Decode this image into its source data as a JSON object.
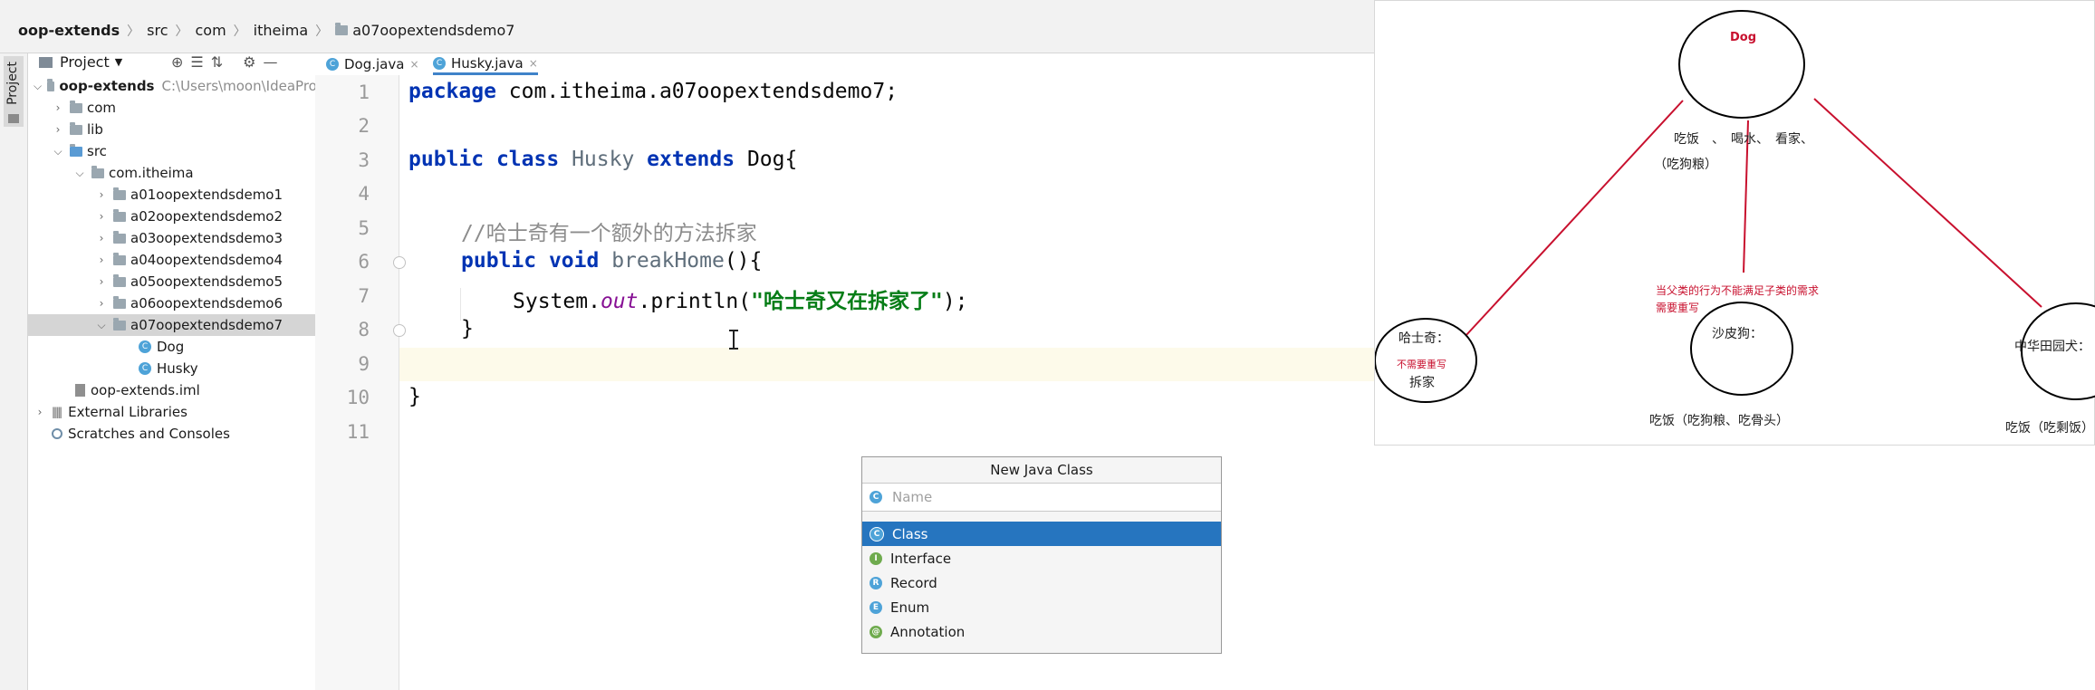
{
  "breadcrumb": [
    "oop-extends",
    "src",
    "com",
    "itheima",
    "a07oopextendsdemo7"
  ],
  "sidebar_stripe": {
    "label": "Project"
  },
  "project_panel": {
    "title": "Project",
    "tools": [
      "⊕",
      "☰",
      "⇅",
      "⚙",
      "—"
    ],
    "tree": [
      {
        "label": "oop-extends",
        "extra": "C:\\Users\\moon\\IdeaProj",
        "icon": "folder-icon",
        "expanded": true
      },
      {
        "label": "com",
        "icon": "folder-icon"
      },
      {
        "label": "lib",
        "icon": "folder-icon"
      },
      {
        "label": "src",
        "icon": "folder-icon",
        "expanded": true
      },
      {
        "label": "com.itheima",
        "icon": "folder-icon",
        "expanded": true
      },
      {
        "label": "a01oopextendsdemo1",
        "icon": "package-icon"
      },
      {
        "label": "a02oopextendsdemo2",
        "icon": "package-icon"
      },
      {
        "label": "a03oopextendsdemo3",
        "icon": "package-icon"
      },
      {
        "label": "a04oopextendsdemo4",
        "icon": "package-icon"
      },
      {
        "label": "a05oopextendsdemo5",
        "icon": "package-icon"
      },
      {
        "label": "a06oopextendsdemo6",
        "icon": "package-icon"
      },
      {
        "label": "a07oopextendsdemo7",
        "icon": "package-icon",
        "expanded": true,
        "selected": true
      },
      {
        "label": "Dog",
        "icon": "class-icon"
      },
      {
        "label": "Husky",
        "icon": "class-icon"
      },
      {
        "label": "oop-extends.iml",
        "icon": "iml-file-icon"
      },
      {
        "label": "External Libraries",
        "icon": "library-icon"
      },
      {
        "label": "Scratches and Consoles",
        "icon": "scratches-icon"
      }
    ]
  },
  "editor": {
    "tabs": [
      {
        "label": "Dog.java",
        "close": "×"
      },
      {
        "label": "Husky.java",
        "close": "×",
        "active": true
      }
    ],
    "line_numbers": [
      "1",
      "2",
      "3",
      "4",
      "5",
      "6",
      "7",
      "8",
      "9",
      "10",
      "11"
    ],
    "code": {
      "l1_kw": "package",
      "l1_rest": " com.itheima.a07oopextendsdemo7;",
      "l3_kw1": "public",
      "l3_kw2": "class",
      "l3_name": "Husky",
      "l3_kw3": "extends",
      "l3_rest": " Dog{",
      "l5_comment": "//哈士奇有一个额外的方法拆家",
      "l6_kw1": "public",
      "l6_kw2": "void",
      "l6_name": "breakHome",
      "l6_rest": "(){",
      "l7_pre": "System.",
      "l7_field": "out",
      "l7_mid": ".println(",
      "l7_str": "\"哈士奇又在拆家了\"",
      "l7_end": ");",
      "l8": "}",
      "l10": "}"
    }
  },
  "new_class_popup": {
    "title": "New Java Class",
    "placeholder": "Name",
    "items": [
      {
        "label": "Class",
        "letter": "C",
        "color": "#4ea3d8",
        "selected": true
      },
      {
        "label": "Interface",
        "letter": "I",
        "color": "#6fab4e"
      },
      {
        "label": "Record",
        "letter": "R",
        "color": "#4ea3d8"
      },
      {
        "label": "Enum",
        "letter": "E",
        "color": "#4ea3d8"
      },
      {
        "label": "Annotation",
        "letter": "@",
        "color": "#6fab4e"
      }
    ]
  },
  "diagram": {
    "parent": "Dog",
    "parent_behaviors": "吃饭　、　喝水、　看家、",
    "parent_behavior_note": "（吃狗粮）",
    "override_note_line1": "当父类的行为不能满足子类的需求",
    "override_note_line2": "需要重写",
    "children": [
      {
        "name": "哈士奇：",
        "note": "不需要重写",
        "extra": "拆家"
      },
      {
        "name": "沙皮狗：",
        "below": "吃饭（吃狗粮、吃骨头）"
      },
      {
        "name": "中华田园犬：",
        "below": "吃饭（吃剩饭）"
      }
    ],
    "colors": {
      "line": "#c8102e",
      "circle": "#000000",
      "note": "#c8102e"
    }
  }
}
